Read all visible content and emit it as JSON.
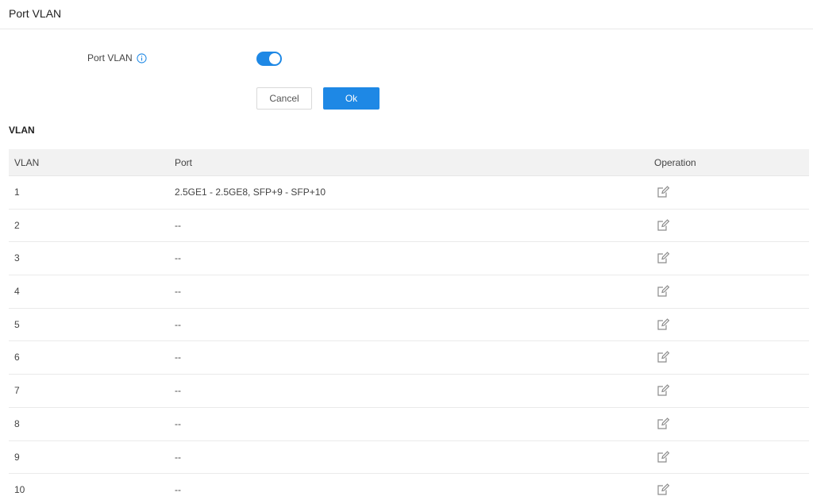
{
  "header": {
    "title": "Port VLAN"
  },
  "form": {
    "port_vlan_label": "Port VLAN",
    "port_vlan_enabled": true,
    "cancel_label": "Cancel",
    "ok_label": "Ok"
  },
  "section": {
    "title": "VLAN"
  },
  "table": {
    "columns": [
      "VLAN",
      "Port",
      "Operation"
    ],
    "rows": [
      {
        "vlan": "1",
        "port": "2.5GE1 - 2.5GE8, SFP+9 - SFP+10"
      },
      {
        "vlan": "2",
        "port": "--"
      },
      {
        "vlan": "3",
        "port": "--"
      },
      {
        "vlan": "4",
        "port": "--"
      },
      {
        "vlan": "5",
        "port": "--"
      },
      {
        "vlan": "6",
        "port": "--"
      },
      {
        "vlan": "7",
        "port": "--"
      },
      {
        "vlan": "8",
        "port": "--"
      },
      {
        "vlan": "9",
        "port": "--"
      },
      {
        "vlan": "10",
        "port": "--"
      }
    ]
  },
  "colors": {
    "accent": "#1e88e5",
    "header_bg": "#f2f2f2",
    "border": "#e8e8e8"
  },
  "icons": {
    "info": "info-circle-icon",
    "edit": "edit-icon"
  }
}
